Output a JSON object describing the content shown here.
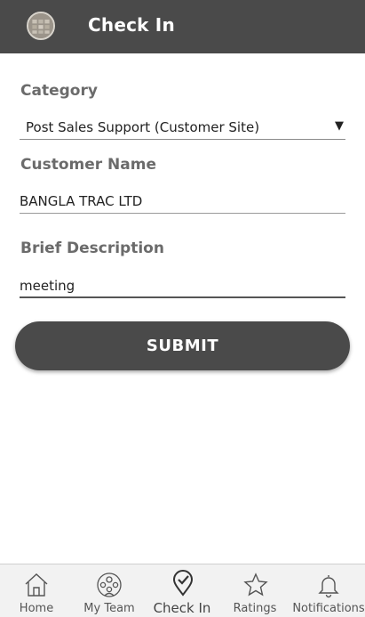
{
  "header": {
    "title": "Check In",
    "avatar_icon": "user-avatar-icon"
  },
  "form": {
    "category": {
      "label": "Category",
      "value": "Post Sales Support (Customer Site)",
      "caret": "▼"
    },
    "customer_name": {
      "label": "Customer Name",
      "value": "BANGLA TRAC LTD"
    },
    "brief_description": {
      "label": "Brief Description",
      "value": "meeting"
    },
    "submit_label": "SUBMIT"
  },
  "bottom_nav": {
    "active": "Check In",
    "items": [
      {
        "label": "Home",
        "icon": "home-icon"
      },
      {
        "label": "My Team",
        "icon": "team-icon"
      },
      {
        "label": "Check In",
        "icon": "check-in-location-icon"
      },
      {
        "label": "Ratings",
        "icon": "star-icon"
      },
      {
        "label": "Notifications",
        "icon": "bell-icon"
      }
    ]
  },
  "colors": {
    "app_bar": "#4a4a4a",
    "button": "#4a4a4a",
    "label": "#6b6b6b",
    "nav_background": "#f2f2f2"
  }
}
